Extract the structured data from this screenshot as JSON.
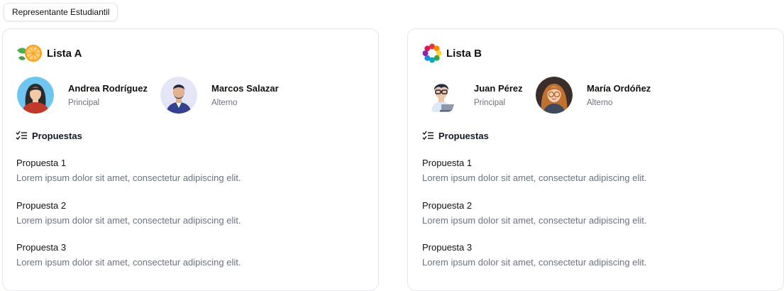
{
  "header": {
    "tag_label": "Representante Estudiantil"
  },
  "lists": [
    {
      "title": "Lista A",
      "logo_icon": "orange-slice-icon",
      "candidates": [
        {
          "name": "Andrea Rodríguez",
          "role": "Principal",
          "avatar": "woman-avatar"
        },
        {
          "name": "Marcos Salazar",
          "role": "Alterno",
          "avatar": "bearded-man-avatar"
        }
      ],
      "proposals_heading": "Propuestas",
      "proposals": [
        {
          "title": "Propuesta 1",
          "description": "Lorem ipsum dolor sit amet, consectetur adipiscing elit."
        },
        {
          "title": "Propuesta 2",
          "description": "Lorem ipsum dolor sit amet, consectetur adipiscing elit."
        },
        {
          "title": "Propuesta 3",
          "description": "Lorem ipsum dolor sit amet, consectetur adipiscing elit."
        }
      ]
    },
    {
      "title": "Lista B",
      "logo_icon": "colorful-flower-icon",
      "candidates": [
        {
          "name": "Juan Pérez",
          "role": "Principal",
          "avatar": "boy-with-laptop-avatar"
        },
        {
          "name": "María Ordóñez",
          "role": "Alterno",
          "avatar": "girl-with-glasses-avatar"
        }
      ],
      "proposals_heading": "Propuestas",
      "proposals": [
        {
          "title": "Propuesta 1",
          "description": "Lorem ipsum dolor sit amet, consectetur adipiscing elit."
        },
        {
          "title": "Propuesta 2",
          "description": "Lorem ipsum dolor sit amet, consectetur adipiscing elit."
        },
        {
          "title": "Propuesta 3",
          "description": "Lorem ipsum dolor sit amet, consectetur adipiscing elit."
        }
      ]
    }
  ]
}
